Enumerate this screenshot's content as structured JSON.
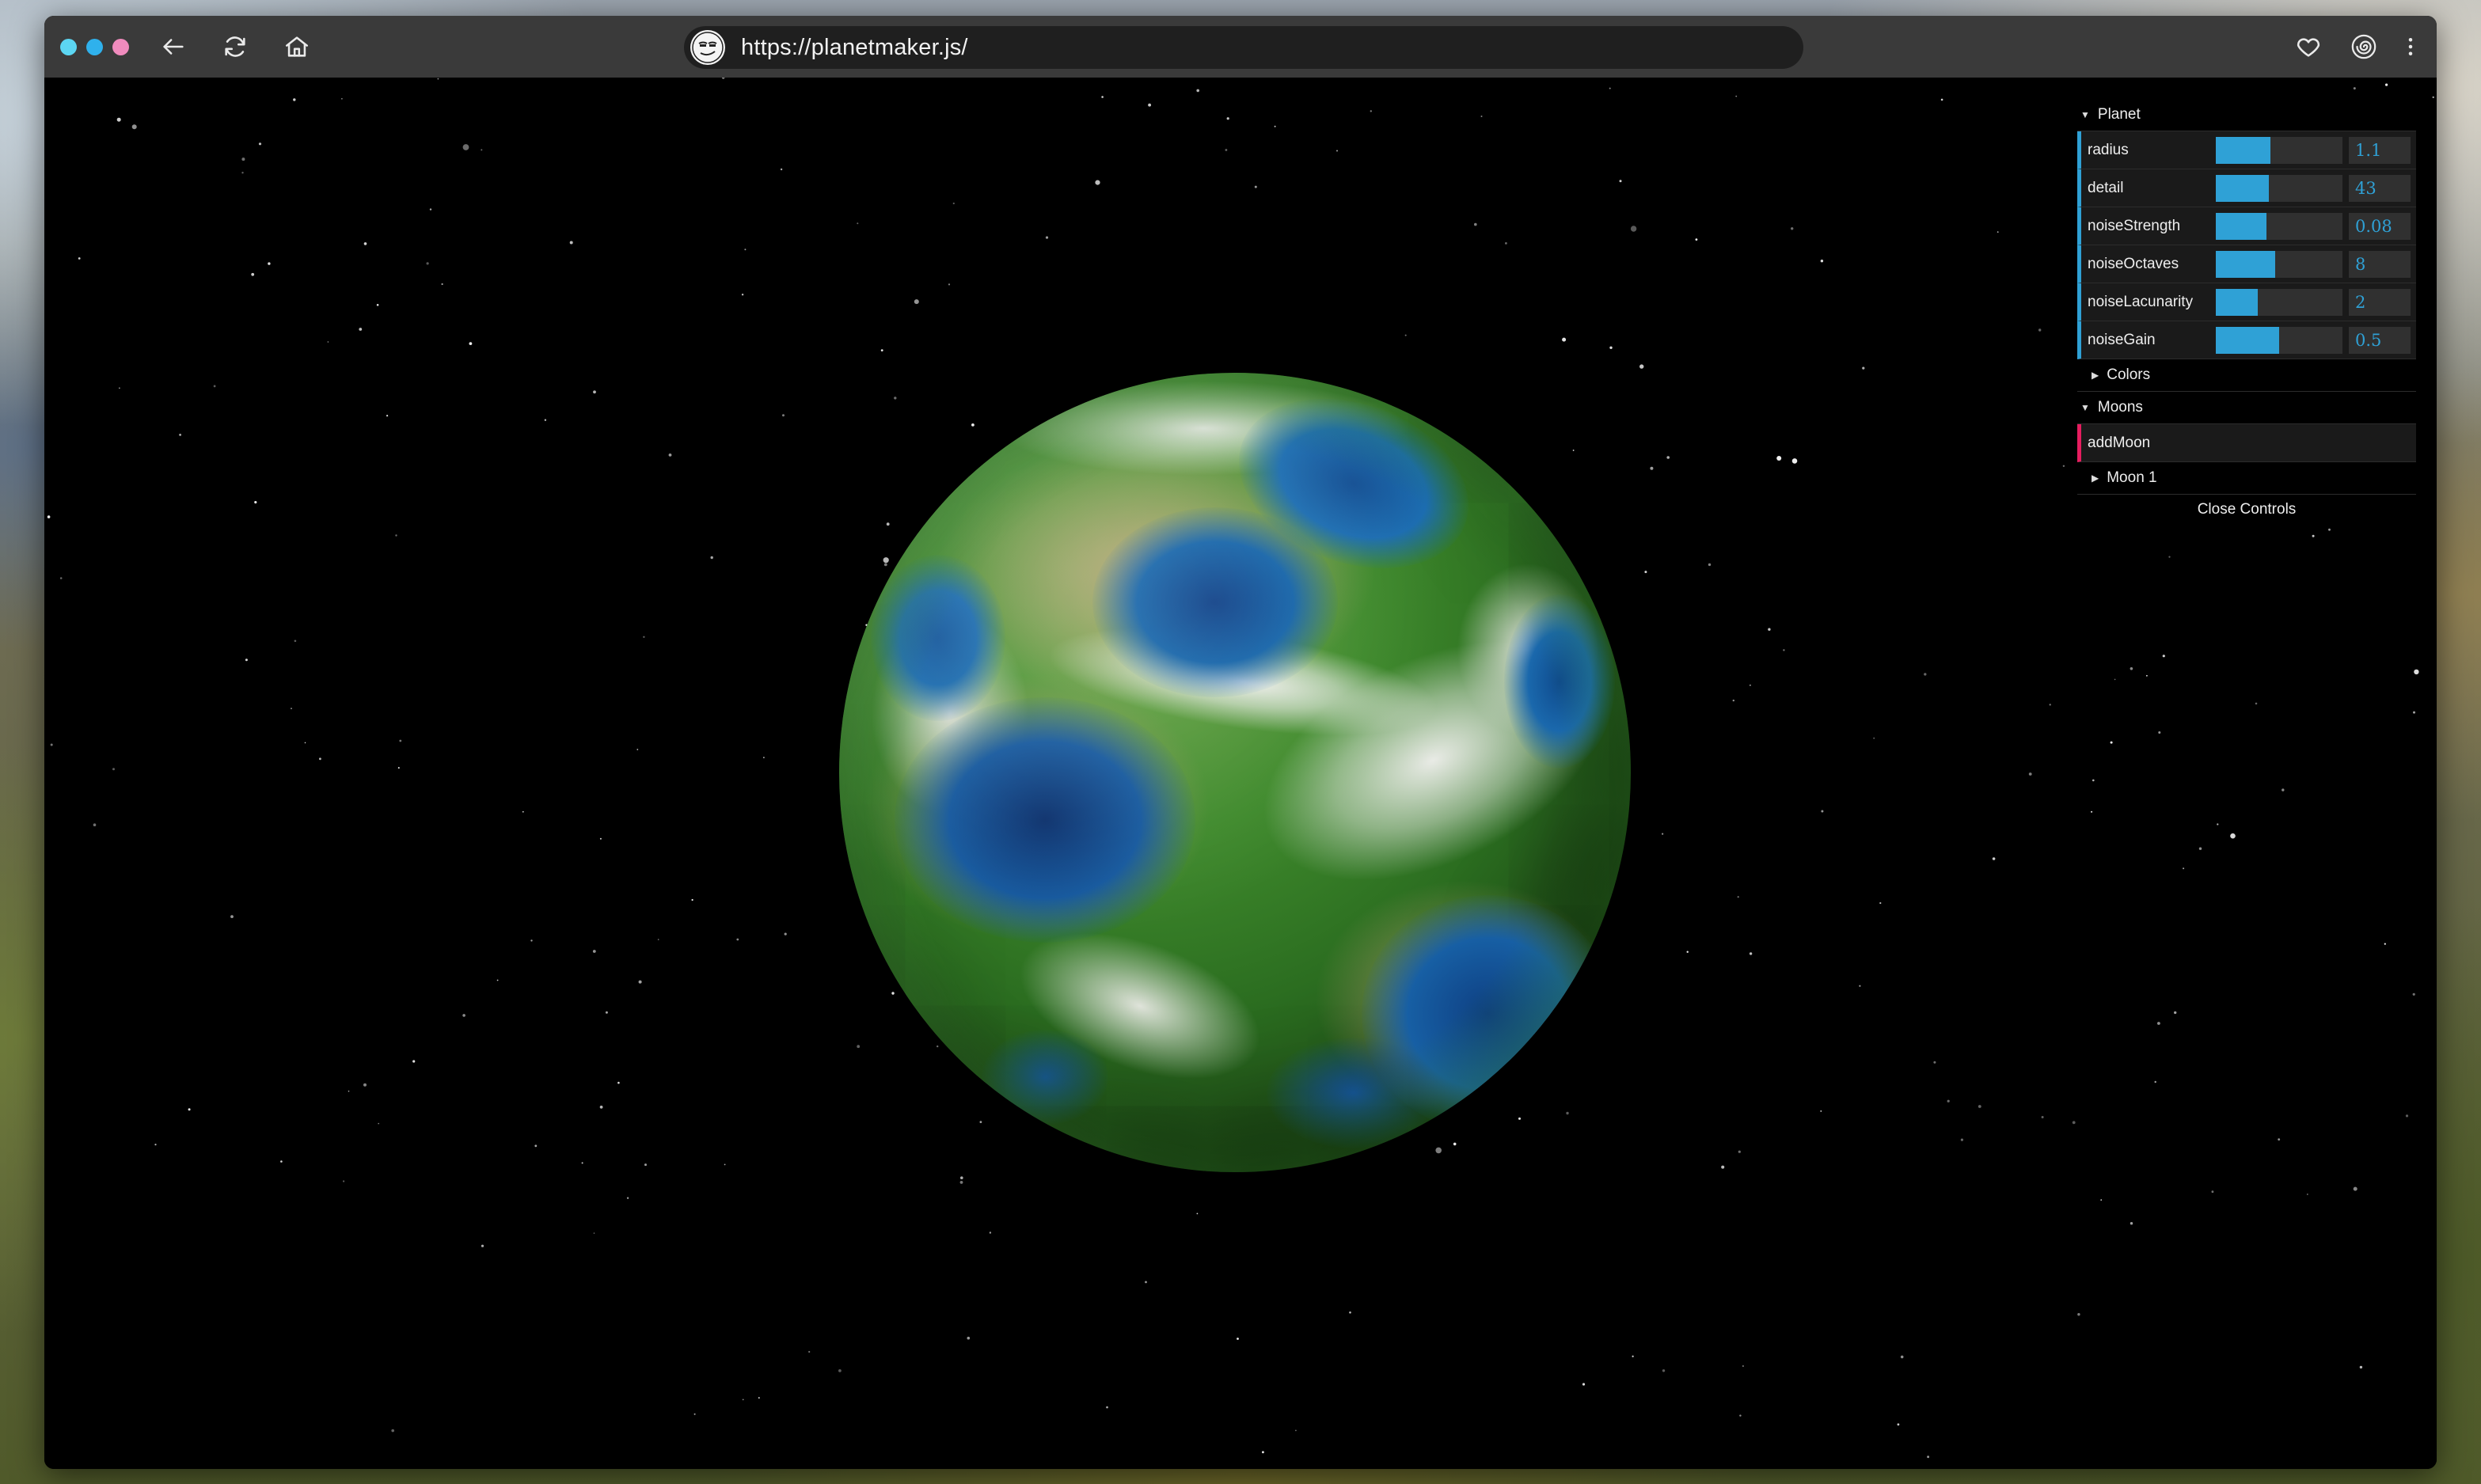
{
  "browser": {
    "url": "https://planetmaker.js/",
    "traffic_lights": [
      "#5cd6f2",
      "#2fb1ec",
      "#f08bbd"
    ],
    "nav_icons": [
      "back-arrow-icon",
      "reload-icon",
      "home-icon"
    ],
    "right_icons": [
      "heart-icon",
      "spiral-icon",
      "more-vertical-icon"
    ]
  },
  "controls": {
    "planet_folder": "Planet",
    "params": [
      {
        "label": "radius",
        "value": "1.1",
        "fill": 0.43
      },
      {
        "label": "detail",
        "value": "43",
        "fill": 0.42
      },
      {
        "label": "noiseStrength",
        "value": "0.08",
        "fill": 0.4
      },
      {
        "label": "noiseOctaves",
        "value": "8",
        "fill": 0.47
      },
      {
        "label": "noiseLacunarity",
        "value": "2",
        "fill": 0.33
      },
      {
        "label": "noiseGain",
        "value": "0.5",
        "fill": 0.5
      }
    ],
    "colors_folder": "Colors",
    "moons_folder": "Moons",
    "add_moon": "addMoon",
    "moon1_folder": "Moon 1",
    "close": "Close Controls"
  },
  "colors": {
    "slider_accent": "#2fa1d6",
    "function_accent": "#e61d5f",
    "panel_bg": "#1a1a1a",
    "space_bg": "#000000"
  }
}
